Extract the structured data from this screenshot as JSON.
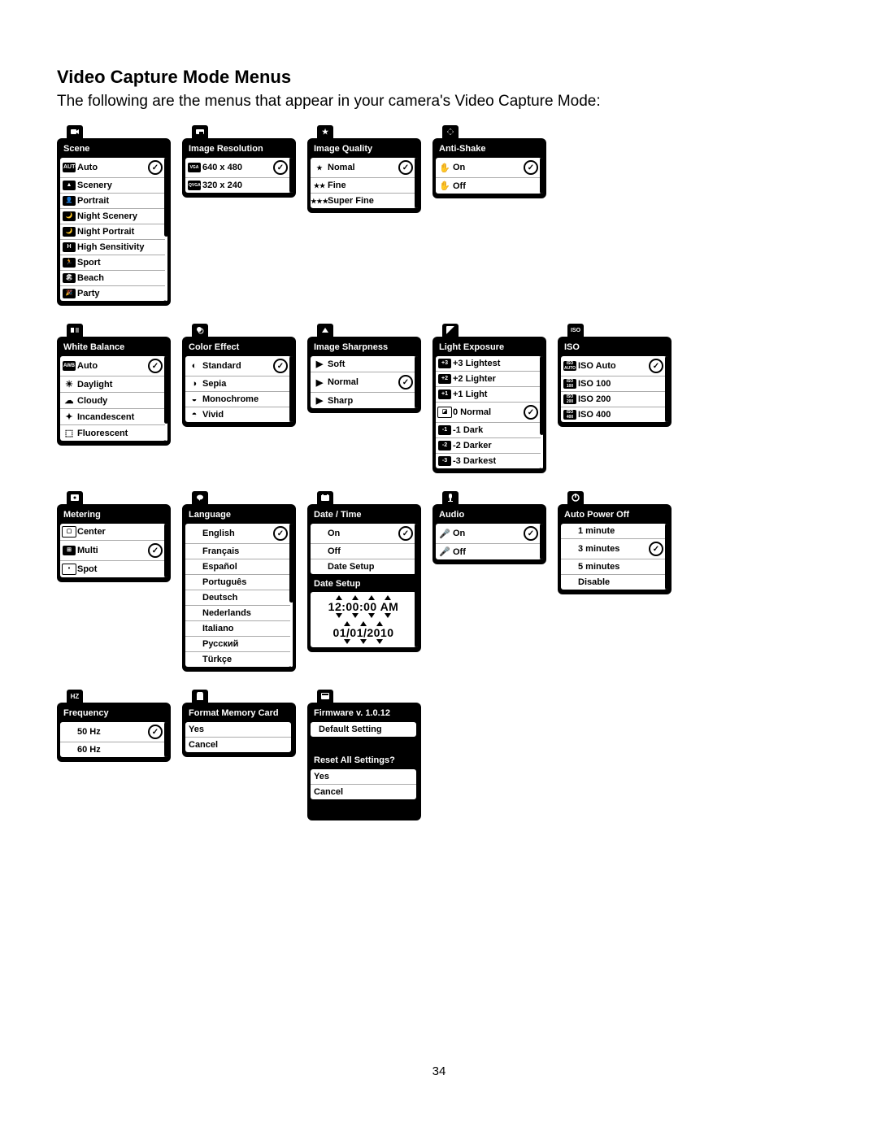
{
  "page": {
    "title": "Video Capture Mode Menus",
    "intro": "The following are the menus that appear in your camera's Video Capture Mode:",
    "page_number": "34"
  },
  "menus": {
    "scene": {
      "title": "Scene",
      "items": [
        "Auto",
        "Scenery",
        "Portrait",
        "Night Scenery",
        "Night Portrait",
        "High Sensitivity",
        "Sport",
        "Beach",
        "Party"
      ],
      "selected_index": 0
    },
    "image_resolution": {
      "title": "Image Resolution",
      "items": [
        "640 x 480",
        "320 x 240"
      ],
      "prefixes": [
        "VGA",
        "QVGA"
      ],
      "selected_index": 0
    },
    "image_quality": {
      "title": "Image Quality",
      "items": [
        "Nomal",
        "Fine",
        "Super Fine"
      ],
      "stars": [
        "★",
        "★★",
        "★★★"
      ],
      "selected_index": 0
    },
    "anti_shake": {
      "title": "Anti-Shake",
      "items": [
        "On",
        "Off"
      ],
      "selected_index": 0
    },
    "white_balance": {
      "title": "White Balance",
      "items": [
        "Auto",
        "Daylight",
        "Cloudy",
        "Incandescent",
        "Fluorescent"
      ],
      "selected_index": 0
    },
    "color_effect": {
      "title": "Color Effect",
      "items": [
        "Standard",
        "Sepia",
        "Monochrome",
        "Vivid"
      ],
      "selected_index": 0
    },
    "image_sharpness": {
      "title": "Image Sharpness",
      "items": [
        "Soft",
        "Normal",
        "Sharp"
      ],
      "selected_index": 1
    },
    "light_exposure": {
      "title": "Light Exposure",
      "items": [
        "+3 Lightest",
        "+2 Lighter",
        "+1 Light",
        "0 Normal",
        "-1 Dark",
        "-2 Darker",
        "-3 Darkest"
      ],
      "selected_index": 3
    },
    "iso": {
      "title": "ISO",
      "items": [
        "ISO Auto",
        "ISO 100",
        "ISO 200",
        "ISO 400"
      ],
      "selected_index": 0
    },
    "metering": {
      "title": "Metering",
      "items": [
        "Center",
        "Multi",
        "Spot"
      ],
      "selected_index": 1
    },
    "language": {
      "title": "Language",
      "items": [
        "English",
        "Français",
        "Español",
        "Português",
        "Deutsch",
        "Nederlands",
        "Italiano",
        "Русский",
        "Türkçe"
      ],
      "selected_index": 0
    },
    "date_time": {
      "title": "Date / Time",
      "items": [
        "On",
        "Off",
        "Date Setup"
      ],
      "selected_index": 0,
      "setup_title": "Date Setup",
      "time": "12:00:00 AM",
      "date": "01/01/2010"
    },
    "audio": {
      "title": "Audio",
      "items": [
        "On",
        "Off"
      ],
      "selected_index": 0
    },
    "auto_power_off": {
      "title": "Auto Power Off",
      "items": [
        "1 minute",
        "3 minutes",
        "5 minutes",
        "Disable"
      ],
      "selected_index": 1
    },
    "frequency": {
      "title": "Frequency",
      "items": [
        "50 Hz",
        "60 Hz"
      ],
      "selected_index": 0
    },
    "format": {
      "title": "Format Memory Card",
      "items": [
        "Yes",
        "Cancel"
      ]
    },
    "firmware": {
      "title": "Firmware v. 1.0.12",
      "items": [
        "Default Setting"
      ],
      "reset_title": "Reset All Settings?",
      "reset_items": [
        "Yes",
        "Cancel"
      ]
    }
  },
  "topicons": {
    "scene": "",
    "image_resolution": "",
    "image_quality": "★",
    "anti_shake": "",
    "white_balance": "",
    "color_effect": "",
    "image_sharpness": "",
    "light_exposure": "",
    "iso": "ISO",
    "metering": "",
    "language": "",
    "date_time": "",
    "audio": "",
    "auto_power_off": "",
    "frequency": "HZ",
    "format": "",
    "firmware": ""
  }
}
